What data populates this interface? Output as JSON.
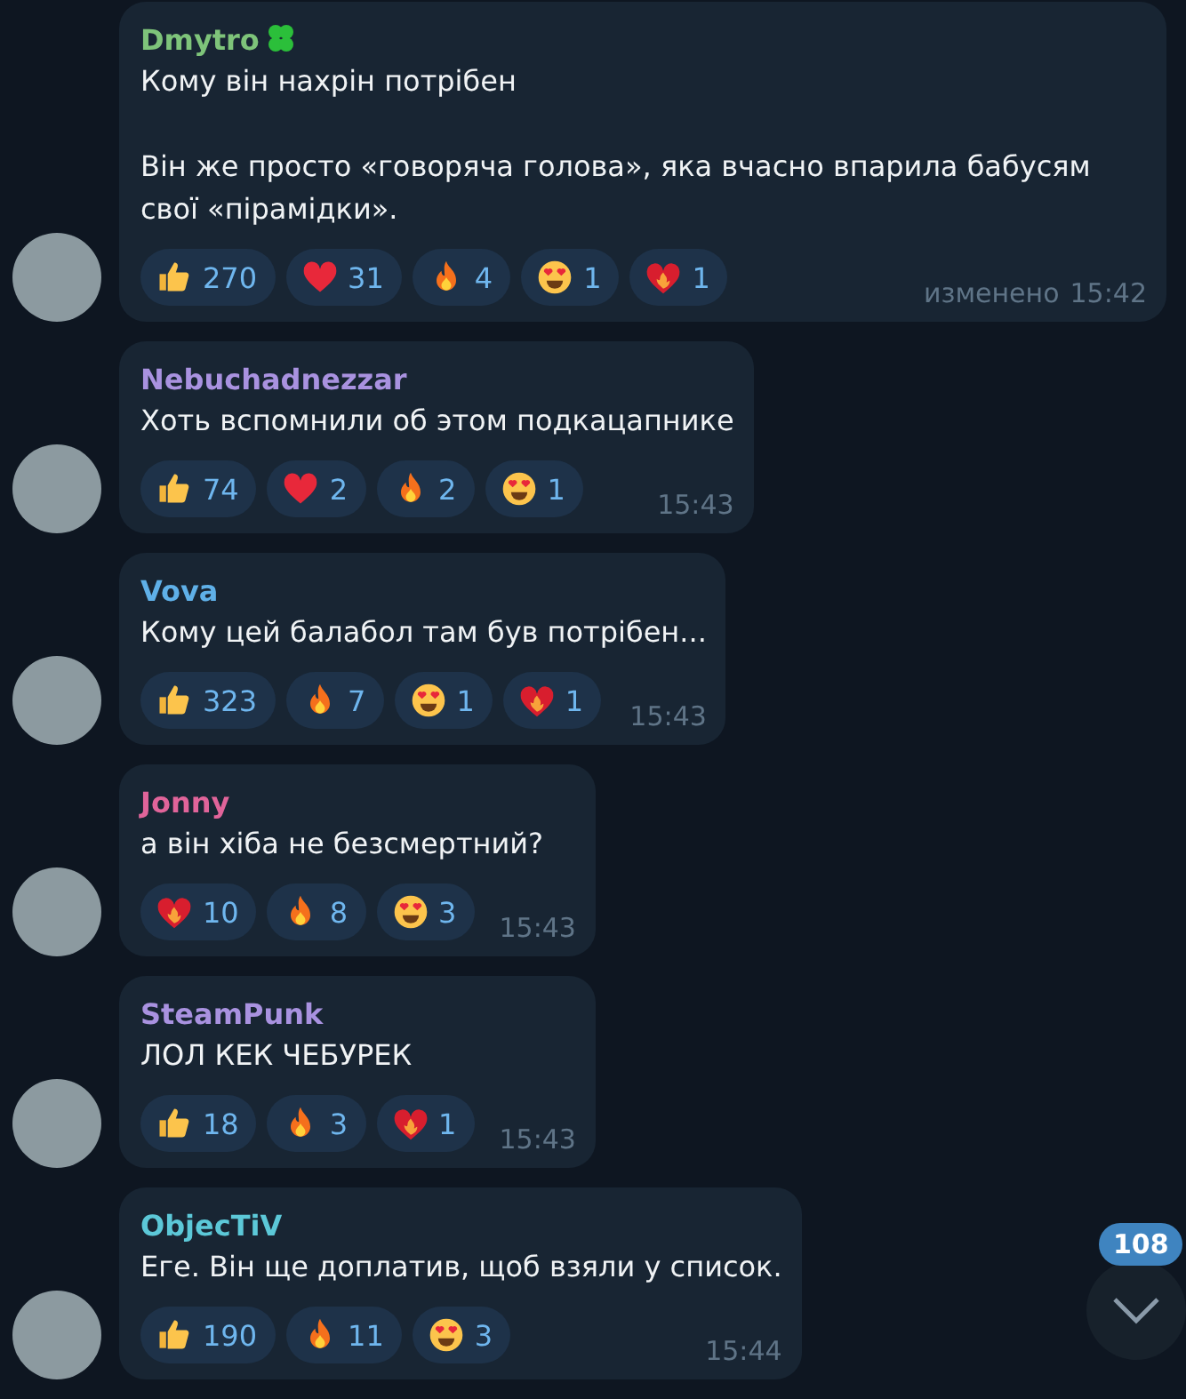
{
  "messages": [
    {
      "author": "Dmytro",
      "color": "#7ec47a",
      "badge": true,
      "paragraphs": [
        "Кому він нахрін потрібен",
        "Він же просто «говоряча голова», яка вчасно впарила бабусям свої «пірамідки»."
      ],
      "reactions": [
        {
          "kind": "thumbs",
          "count": "270"
        },
        {
          "kind": "heart",
          "count": "31"
        },
        {
          "kind": "fire",
          "count": "4"
        },
        {
          "kind": "love",
          "count": "1"
        },
        {
          "kind": "heartfire",
          "count": "1"
        }
      ],
      "edited": "изменено",
      "time": "15:42"
    },
    {
      "author": "Nebuchadnezzar",
      "color": "#a992e0",
      "badge": false,
      "paragraphs": [
        "Хоть вспомнили об этом подкацапнике"
      ],
      "reactions": [
        {
          "kind": "thumbs",
          "count": "74"
        },
        {
          "kind": "heart",
          "count": "2"
        },
        {
          "kind": "fire",
          "count": "2"
        },
        {
          "kind": "love",
          "count": "1"
        }
      ],
      "time": "15:43"
    },
    {
      "author": "Vova",
      "color": "#5fb0e8",
      "badge": false,
      "paragraphs": [
        "Кому цей балабол там був потрібен..."
      ],
      "reactions": [
        {
          "kind": "thumbs",
          "count": "323"
        },
        {
          "kind": "fire",
          "count": "7"
        },
        {
          "kind": "love",
          "count": "1"
        },
        {
          "kind": "heartfire",
          "count": "1"
        }
      ],
      "time": "15:43"
    },
    {
      "author": "Jonny",
      "color": "#e0649a",
      "badge": false,
      "paragraphs": [
        "а він хіба не безсмертний?"
      ],
      "reactions": [
        {
          "kind": "heartfire",
          "count": "10"
        },
        {
          "kind": "fire",
          "count": "8"
        },
        {
          "kind": "love",
          "count": "3"
        }
      ],
      "time": "15:43"
    },
    {
      "author": "SteamPunk",
      "color": "#a992e0",
      "badge": false,
      "paragraphs": [
        "ЛОЛ КЕК ЧЕБУРЕК"
      ],
      "reactions": [
        {
          "kind": "thumbs",
          "count": "18"
        },
        {
          "kind": "fire",
          "count": "3"
        },
        {
          "kind": "heartfire",
          "count": "1"
        }
      ],
      "time": "15:43"
    },
    {
      "author": "ObjecTiV",
      "color": "#5cc8d8",
      "badge": false,
      "paragraphs": [
        "Еге. Він ще доплатив, щоб взяли у список."
      ],
      "reactions": [
        {
          "kind": "thumbs",
          "count": "190"
        },
        {
          "kind": "fire",
          "count": "11"
        },
        {
          "kind": "love",
          "count": "3"
        }
      ],
      "time": "15:44"
    }
  ],
  "scroll_button": {
    "unread": "108"
  }
}
